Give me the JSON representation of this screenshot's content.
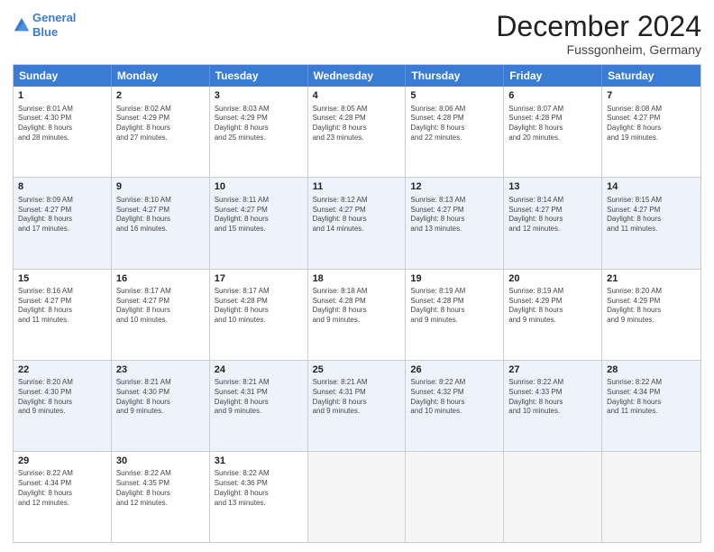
{
  "logo": {
    "line1": "General",
    "line2": "Blue"
  },
  "title": "December 2024",
  "location": "Fussgonheim, Germany",
  "days_of_week": [
    "Sunday",
    "Monday",
    "Tuesday",
    "Wednesday",
    "Thursday",
    "Friday",
    "Saturday"
  ],
  "rows": [
    [
      {
        "day": "1",
        "lines": [
          "Sunrise: 8:01 AM",
          "Sunset: 4:30 PM",
          "Daylight: 8 hours",
          "and 28 minutes."
        ]
      },
      {
        "day": "2",
        "lines": [
          "Sunrise: 8:02 AM",
          "Sunset: 4:29 PM",
          "Daylight: 8 hours",
          "and 27 minutes."
        ]
      },
      {
        "day": "3",
        "lines": [
          "Sunrise: 8:03 AM",
          "Sunset: 4:29 PM",
          "Daylight: 8 hours",
          "and 25 minutes."
        ]
      },
      {
        "day": "4",
        "lines": [
          "Sunrise: 8:05 AM",
          "Sunset: 4:28 PM",
          "Daylight: 8 hours",
          "and 23 minutes."
        ]
      },
      {
        "day": "5",
        "lines": [
          "Sunrise: 8:06 AM",
          "Sunset: 4:28 PM",
          "Daylight: 8 hours",
          "and 22 minutes."
        ]
      },
      {
        "day": "6",
        "lines": [
          "Sunrise: 8:07 AM",
          "Sunset: 4:28 PM",
          "Daylight: 8 hours",
          "and 20 minutes."
        ]
      },
      {
        "day": "7",
        "lines": [
          "Sunrise: 8:08 AM",
          "Sunset: 4:27 PM",
          "Daylight: 8 hours",
          "and 19 minutes."
        ]
      }
    ],
    [
      {
        "day": "8",
        "lines": [
          "Sunrise: 8:09 AM",
          "Sunset: 4:27 PM",
          "Daylight: 8 hours",
          "and 17 minutes."
        ]
      },
      {
        "day": "9",
        "lines": [
          "Sunrise: 8:10 AM",
          "Sunset: 4:27 PM",
          "Daylight: 8 hours",
          "and 16 minutes."
        ]
      },
      {
        "day": "10",
        "lines": [
          "Sunrise: 8:11 AM",
          "Sunset: 4:27 PM",
          "Daylight: 8 hours",
          "and 15 minutes."
        ]
      },
      {
        "day": "11",
        "lines": [
          "Sunrise: 8:12 AM",
          "Sunset: 4:27 PM",
          "Daylight: 8 hours",
          "and 14 minutes."
        ]
      },
      {
        "day": "12",
        "lines": [
          "Sunrise: 8:13 AM",
          "Sunset: 4:27 PM",
          "Daylight: 8 hours",
          "and 13 minutes."
        ]
      },
      {
        "day": "13",
        "lines": [
          "Sunrise: 8:14 AM",
          "Sunset: 4:27 PM",
          "Daylight: 8 hours",
          "and 12 minutes."
        ]
      },
      {
        "day": "14",
        "lines": [
          "Sunrise: 8:15 AM",
          "Sunset: 4:27 PM",
          "Daylight: 8 hours",
          "and 11 minutes."
        ]
      }
    ],
    [
      {
        "day": "15",
        "lines": [
          "Sunrise: 8:16 AM",
          "Sunset: 4:27 PM",
          "Daylight: 8 hours",
          "and 11 minutes."
        ]
      },
      {
        "day": "16",
        "lines": [
          "Sunrise: 8:17 AM",
          "Sunset: 4:27 PM",
          "Daylight: 8 hours",
          "and 10 minutes."
        ]
      },
      {
        "day": "17",
        "lines": [
          "Sunrise: 8:17 AM",
          "Sunset: 4:28 PM",
          "Daylight: 8 hours",
          "and 10 minutes."
        ]
      },
      {
        "day": "18",
        "lines": [
          "Sunrise: 8:18 AM",
          "Sunset: 4:28 PM",
          "Daylight: 8 hours",
          "and 9 minutes."
        ]
      },
      {
        "day": "19",
        "lines": [
          "Sunrise: 8:19 AM",
          "Sunset: 4:28 PM",
          "Daylight: 8 hours",
          "and 9 minutes."
        ]
      },
      {
        "day": "20",
        "lines": [
          "Sunrise: 8:19 AM",
          "Sunset: 4:29 PM",
          "Daylight: 8 hours",
          "and 9 minutes."
        ]
      },
      {
        "day": "21",
        "lines": [
          "Sunrise: 8:20 AM",
          "Sunset: 4:29 PM",
          "Daylight: 8 hours",
          "and 9 minutes."
        ]
      }
    ],
    [
      {
        "day": "22",
        "lines": [
          "Sunrise: 8:20 AM",
          "Sunset: 4:30 PM",
          "Daylight: 8 hours",
          "and 9 minutes."
        ]
      },
      {
        "day": "23",
        "lines": [
          "Sunrise: 8:21 AM",
          "Sunset: 4:30 PM",
          "Daylight: 8 hours",
          "and 9 minutes."
        ]
      },
      {
        "day": "24",
        "lines": [
          "Sunrise: 8:21 AM",
          "Sunset: 4:31 PM",
          "Daylight: 8 hours",
          "and 9 minutes."
        ]
      },
      {
        "day": "25",
        "lines": [
          "Sunrise: 8:21 AM",
          "Sunset: 4:31 PM",
          "Daylight: 8 hours",
          "and 9 minutes."
        ]
      },
      {
        "day": "26",
        "lines": [
          "Sunrise: 8:22 AM",
          "Sunset: 4:32 PM",
          "Daylight: 8 hours",
          "and 10 minutes."
        ]
      },
      {
        "day": "27",
        "lines": [
          "Sunrise: 8:22 AM",
          "Sunset: 4:33 PM",
          "Daylight: 8 hours",
          "and 10 minutes."
        ]
      },
      {
        "day": "28",
        "lines": [
          "Sunrise: 8:22 AM",
          "Sunset: 4:34 PM",
          "Daylight: 8 hours",
          "and 11 minutes."
        ]
      }
    ],
    [
      {
        "day": "29",
        "lines": [
          "Sunrise: 8:22 AM",
          "Sunset: 4:34 PM",
          "Daylight: 8 hours",
          "and 12 minutes."
        ]
      },
      {
        "day": "30",
        "lines": [
          "Sunrise: 8:22 AM",
          "Sunset: 4:35 PM",
          "Daylight: 8 hours",
          "and 12 minutes."
        ]
      },
      {
        "day": "31",
        "lines": [
          "Sunrise: 8:22 AM",
          "Sunset: 4:36 PM",
          "Daylight: 8 hours",
          "and 13 minutes."
        ]
      },
      {
        "day": "",
        "lines": []
      },
      {
        "day": "",
        "lines": []
      },
      {
        "day": "",
        "lines": []
      },
      {
        "day": "",
        "lines": []
      }
    ]
  ]
}
